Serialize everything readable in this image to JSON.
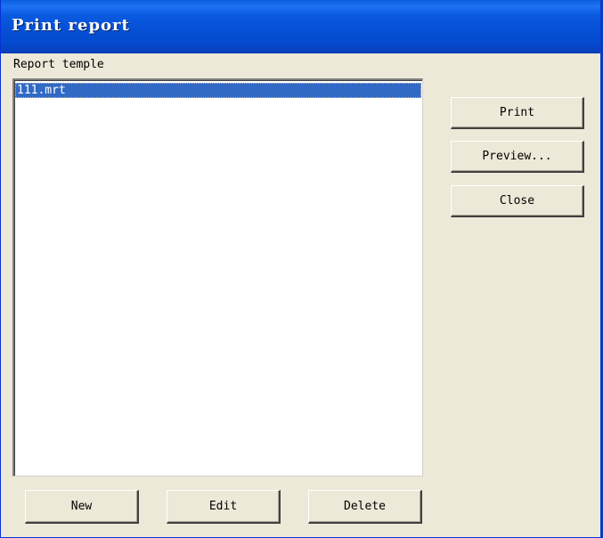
{
  "window": {
    "title": "Print report"
  },
  "template_label": "Report temple",
  "templates": {
    "items": [
      {
        "label": "111.mrt",
        "selected": true
      }
    ]
  },
  "side_buttons": {
    "print": "Print",
    "preview": "Preview...",
    "close": "Close"
  },
  "bottom_buttons": {
    "new": "New",
    "edit": "Edit",
    "delete": "Delete"
  },
  "colors": {
    "titlebar": "#0550d6",
    "selection": "#316ac5",
    "dialog_background": "#ece9d8"
  }
}
